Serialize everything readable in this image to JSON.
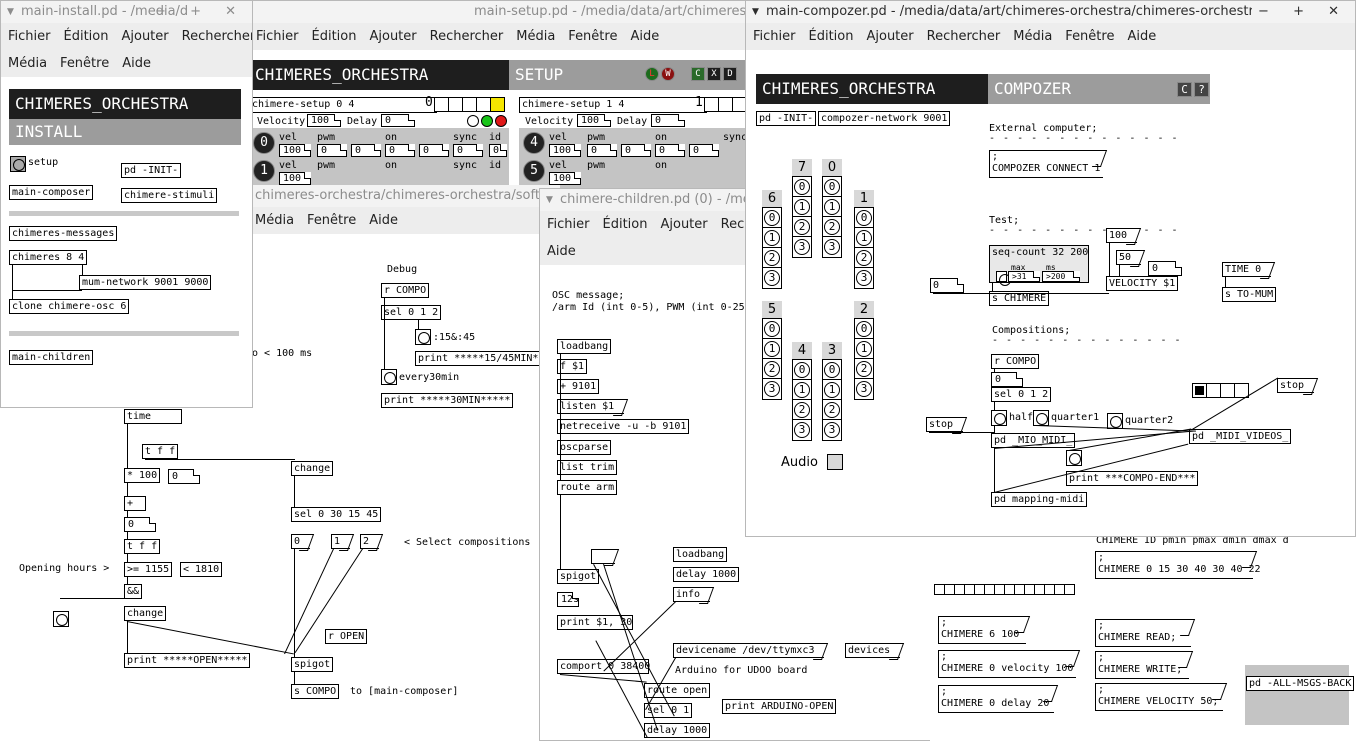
{
  "install": {
    "title": "main-install.pd  - /media/d",
    "menu": [
      "Fichier",
      "Édition",
      "Ajouter",
      "Rechercher",
      "Média",
      "Fenêtre",
      "Aide"
    ],
    "hdr1": "CHIMERES_ORCHESTRA",
    "hdr2": "INSTALL",
    "setup": "setup",
    "init": "pd -INIT-",
    "composer": "main-composer",
    "stimuli": "chimere-stimuli",
    "messages": "chimeres-messages",
    "chimeres": "chimeres 8 4",
    "network": "mum-network 9001 9000",
    "clone": "clone chimere-osc 6",
    "children": "main-children"
  },
  "setup": {
    "title": "main-setup.pd  - /media/data/art/chimeres-orch",
    "menu": [
      "Fichier",
      "Édition",
      "Ajouter",
      "Rechercher",
      "Média",
      "Fenêtre",
      "Aide"
    ],
    "hdr1": "CHIMERES_ORCHESTRA",
    "hdr2": "SETUP",
    "btn_l": "L",
    "btn_w": "W",
    "btn_c": "C",
    "btn_x": "X",
    "btn_d": "D",
    "sa": "chimere-setup 0 4",
    "sa_n": "0",
    "sb": "chimere-setup 1 4",
    "sb_n": "1",
    "velocity": "Velocity",
    "delay": "Delay",
    "vel100": "100",
    "d0": "0",
    "cols": [
      "vel",
      "pwm",
      "on",
      "sync",
      "id"
    ],
    "v100": "100",
    "z": "0",
    "id0": "0",
    "id1": "1",
    "id4": "4",
    "id5": "5"
  },
  "main": {
    "title": "chimeres-orchestra/chimeres-orchestra/softwa",
    "menu": [
      "Média",
      "Fenêtre",
      "Aide"
    ],
    "debug": "Debug",
    "rcompo": "r COMPO",
    "sel012": "sel 0 1 2",
    "t1545": ":15&:45",
    "p1545": "print *****15/45MIN*",
    "every30": "every30min",
    "p30": "print *****30MIN*****",
    "lt100": "o < 100 ms",
    "time": "time",
    "tff": "t f f",
    "mul100": "* 100",
    "zero": "0",
    "change": "change",
    "plus": "+",
    "tff2": "t f f",
    "sel0301545": "sel 0 30 15 45",
    "m0": "0",
    "m1": "1",
    "m2": "2",
    "selcomp": "< Select compositions",
    "opening": "Opening hours >",
    "ge1155": ">= 1155",
    "lt1810": "< 1810",
    "and": "&&",
    "change2": "change",
    "ropen": "r OPEN",
    "popen": "print *****OPEN*****",
    "spigot": "spigot",
    "scompo": "s COMPO",
    "to": "to [main-composer]"
  },
  "children": {
    "title": "chimere-children.pd  (0) - /me",
    "menu": [
      "Fichier",
      "Édition",
      "Ajouter",
      "Recherc",
      "Aide"
    ],
    "osc1": "OSC message;",
    "osc2": "/arm Id (int 0-5), PWM (int 0-25",
    "loadbang": "loadbang",
    "f1": "f $1",
    "p9101": "+ 9101",
    "listen": "listen $1",
    "netrec": "netreceive -u -b 9101",
    "oscparse": "oscparse",
    "listtrim": "list trim",
    "routearm": "route arm",
    "lb2": "loadbang",
    "d1000": "delay 1000",
    "info": "info",
    "spigot": "spigot",
    "n12": "12s",
    "print": "print $1, 30",
    "devname": "devicename /dev/ttymxc3",
    "devices": "devices",
    "comport": "comport 0 38400",
    "arduino": "Arduino for UDOO board",
    "routeopen": "route open",
    "sel01": "sel 0 1",
    "parduino": "print ARDUINO-OPEN",
    "d1000b": "delay 1000"
  },
  "composer": {
    "title": "main-compozer.pd  - /media/data/art/chimeres-orchestra/chimeres-orchestra/software",
    "menu": [
      "Fichier",
      "Édition",
      "Ajouter",
      "Rechercher",
      "Média",
      "Fenêtre",
      "Aide"
    ],
    "hdr1": "CHIMERES_ORCHESTRA",
    "hdr2": "COMPOZER",
    "hbtn1": "C",
    "hbtn2": "?",
    "init": "pd -INIT-",
    "network": "compozer-network 9001",
    "ext": "External computer;",
    "connect": "COMPOZER CONNECT 1",
    "test": "Test;",
    "seqcount": "seq-count 32 200",
    "max": "max",
    "ms": "ms",
    "v31": ">31",
    "v200": ">200",
    "schimere": "s CHIMERE",
    "n100": "100",
    "n50": "50",
    "n0": "0",
    "velocity": "VELOCITY $1",
    "timeb": "TIME 0",
    "stomum": "s TO-MUM",
    "compositions": "Compositions;",
    "rcompo": "r COMPO",
    "zero": "0",
    "sel012": "sel 0 1 2",
    "half": "half",
    "quarter1": "quarter1",
    "quarter2": "quarter2",
    "stop": "stop",
    "stop2": "stop",
    "miomidi": "pd _MIO_MIDI_",
    "midivideos": "pd _MIDI_VIDEOS_",
    "pend": "print ***COMPO-END***",
    "mapping": "pd mapping-midi",
    "audio": "Audio",
    "radios": {
      "r6": "6",
      "r7": "7",
      "r0": "0",
      "r1": "1",
      "r5": "5",
      "r4": "4",
      "r3": "3",
      "r2": "2"
    }
  },
  "bottom": {
    "hdr": "CHIMERE ID pmin pmax dmin dmax d",
    "c0": "CHIMERE 0 15 30 40 30 40 22",
    "c6": "CHIMERE 6 100",
    "cv": "CHIMERE 0 velocity 100",
    "cd": "CHIMERE 0 delay 20",
    "cr": "CHIMERE READ;",
    "cw": "CHIMERE WRITE;",
    "cvel": "CHIMERE VELOCITY 50;",
    "allmsgs": "pd -ALL-MSGS-BACK"
  }
}
